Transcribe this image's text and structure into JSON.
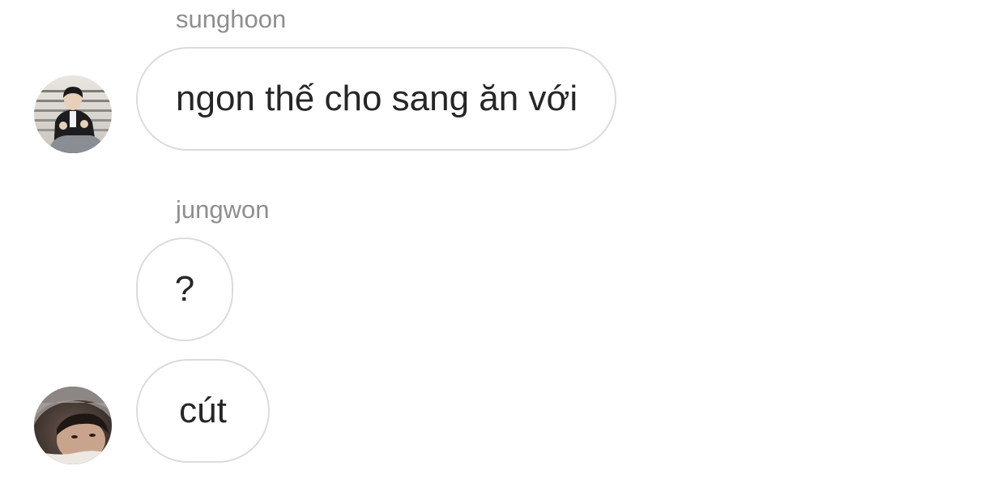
{
  "thread": {
    "messages": [
      {
        "sender": "sunghoon",
        "text": "ngon thế cho sang ăn với"
      },
      {
        "sender": "jungwon",
        "text": "?"
      },
      {
        "sender": "",
        "text": "cút"
      }
    ]
  },
  "avatars": {
    "sunghoon": "user-avatar-photo",
    "jungwon": "user-avatar-photo"
  },
  "colors": {
    "bubble_border": "#dbdbdb",
    "message_text": "#262626",
    "sender_name": "#8e8e8e",
    "background": "#ffffff"
  }
}
